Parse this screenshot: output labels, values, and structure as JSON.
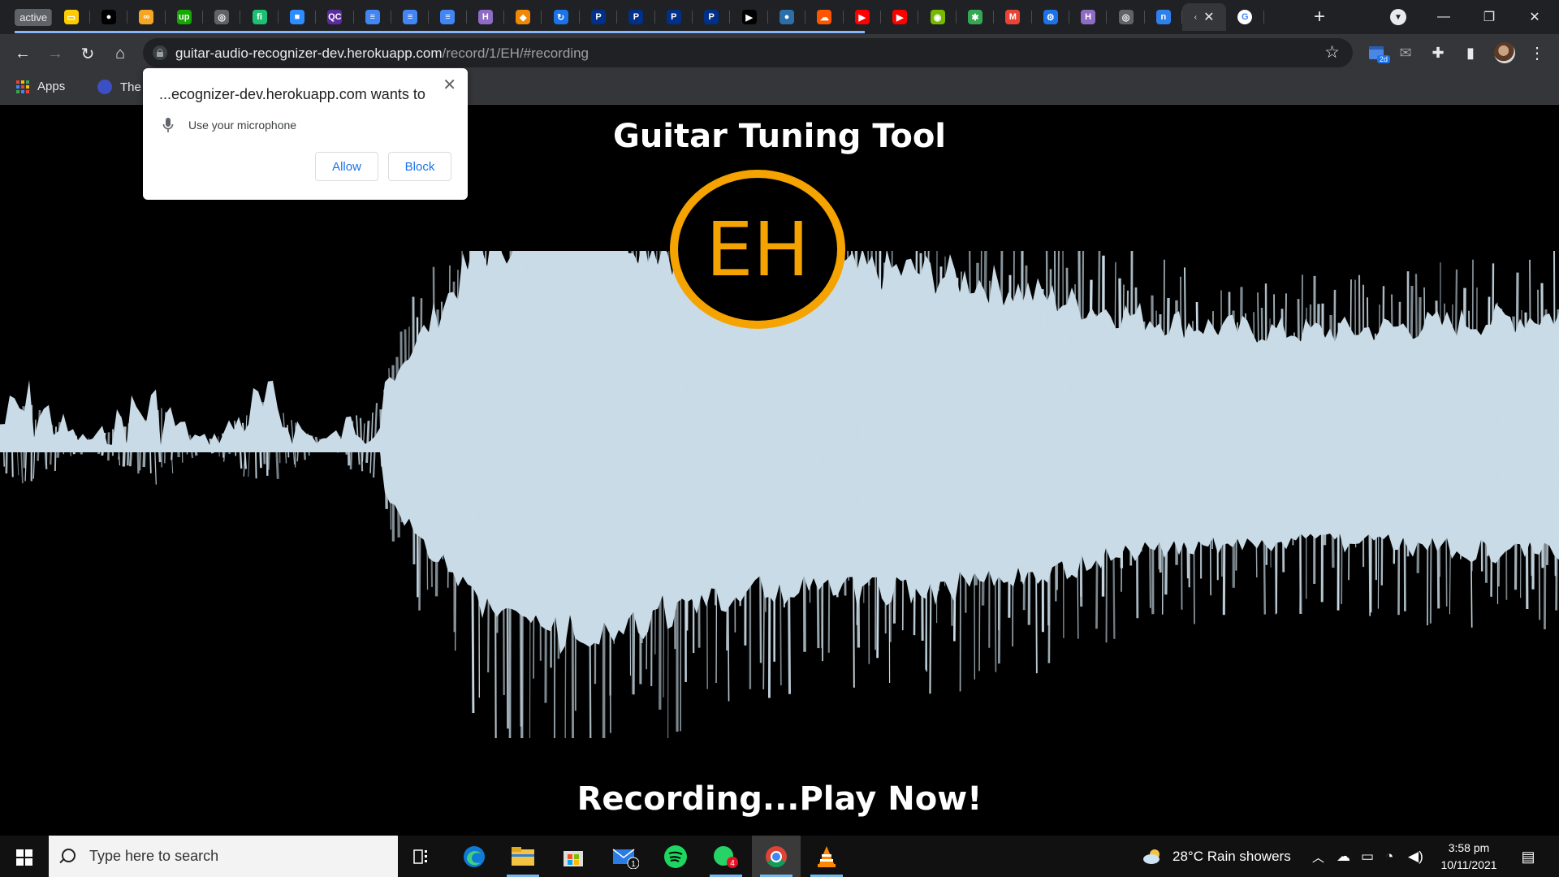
{
  "browser": {
    "tabs": [
      {
        "kind": "active-label",
        "label": "active",
        "color": "#5f6368"
      },
      {
        "icon": "mtn-icon",
        "glyph": "▭",
        "color": "#ffcc00"
      },
      {
        "icon": "medium-icon",
        "glyph": "●",
        "color": "#000000"
      },
      {
        "icon": "coursera-icon",
        "glyph": "∞",
        "color": "#f5a623"
      },
      {
        "icon": "upwork-icon",
        "glyph": "up",
        "color": "#14a800"
      },
      {
        "icon": "globe-icon",
        "glyph": "◎",
        "color": "#5f6368"
      },
      {
        "icon": "fiverr-icon",
        "glyph": "fi",
        "color": "#1dbf73"
      },
      {
        "icon": "zoom-icon",
        "glyph": "■",
        "color": "#2d8cff"
      },
      {
        "icon": "qc-icon",
        "glyph": "QC",
        "color": "#5b2ca0"
      },
      {
        "icon": "docs-icon",
        "glyph": "≡",
        "color": "#4285f4"
      },
      {
        "icon": "docs-icon",
        "glyph": "≡",
        "color": "#4285f4"
      },
      {
        "icon": "docs-icon",
        "glyph": "≡",
        "color": "#4285f4"
      },
      {
        "icon": "hackmd-icon",
        "glyph": "H",
        "color": "#8e6cc4"
      },
      {
        "icon": "diagram-icon",
        "glyph": "◆",
        "color": "#f08705"
      },
      {
        "icon": "refresh-icon",
        "glyph": "↻",
        "color": "#1a73e8"
      },
      {
        "icon": "paypal-icon",
        "glyph": "P",
        "color": "#003087"
      },
      {
        "icon": "paypal-icon",
        "glyph": "P",
        "color": "#003087"
      },
      {
        "icon": "paypal-icon",
        "glyph": "P",
        "color": "#003087"
      },
      {
        "icon": "paypal-icon",
        "glyph": "P",
        "color": "#003087"
      },
      {
        "icon": "play-store-icon",
        "glyph": "▶",
        "color": "#000000"
      },
      {
        "icon": "planet-icon",
        "glyph": "●",
        "color": "#2b6ea8"
      },
      {
        "icon": "soundcloud-icon",
        "glyph": "☁",
        "color": "#ff5500"
      },
      {
        "icon": "youtube-icon",
        "glyph": "▶",
        "color": "#ff0000"
      },
      {
        "icon": "youtube-icon",
        "glyph": "▶",
        "color": "#ff0000"
      },
      {
        "icon": "nvidia-icon",
        "glyph": "◉",
        "color": "#76b900"
      },
      {
        "icon": "pinwheel-icon",
        "glyph": "✱",
        "color": "#34a853"
      },
      {
        "icon": "gmail-icon",
        "glyph": "M",
        "color": "#ea4335"
      },
      {
        "icon": "settings-icon",
        "glyph": "⚙",
        "color": "#1a73e8"
      },
      {
        "icon": "hackmd-icon",
        "glyph": "H",
        "color": "#8e6cc4"
      },
      {
        "icon": "globe-icon",
        "glyph": "◎",
        "color": "#5f6368"
      },
      {
        "icon": "notion-icon",
        "glyph": "n",
        "color": "#2f80ed"
      },
      {
        "kind": "active",
        "icon": "loading-icon",
        "glyph": "‹",
        "close": "✕"
      },
      {
        "icon": "google-icon",
        "glyph": "G",
        "color": "#ffffff"
      }
    ],
    "url_host": "guitar-audio-recognizer-dev.herokuapp.com",
    "url_path": "/record/1/EH/#recording",
    "extension_badge": "2d",
    "bookmarks": {
      "apps": "Apps",
      "item": "The We"
    }
  },
  "permission_popup": {
    "title": "...ecognizer-dev.herokuapp.com wants to",
    "permission": "Use your microphone",
    "allow": "Allow",
    "block": "Block",
    "close": "✕"
  },
  "page": {
    "title": "Guitar Tuning Tool",
    "logo_text": "EH",
    "status": "Recording...Play Now!",
    "accent_color": "#f5a300",
    "wave_color": "#c9dbe6"
  },
  "taskbar": {
    "search_placeholder": "Type here to search",
    "mail_badge": "1",
    "whatsapp_badge": "4",
    "weather": "28°C  Rain showers",
    "time": "3:58 pm",
    "date": "10/11/2021"
  }
}
